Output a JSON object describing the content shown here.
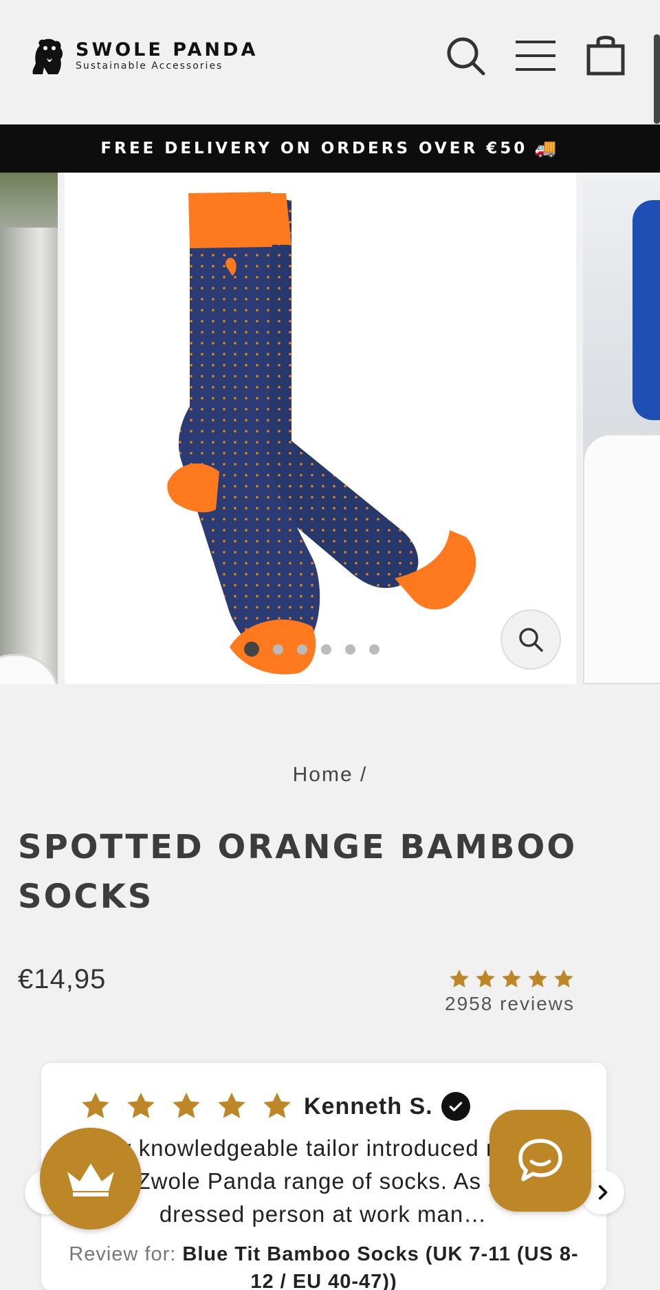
{
  "header": {
    "brand_name": "SWOLE PANDA",
    "brand_tagline": "Sustainable Accessories"
  },
  "banner": {
    "text": "FREE DELIVERY ON ORDERS OVER €50",
    "emoji": "🚚"
  },
  "gallery": {
    "slide_count": 6,
    "active_slide": 1
  },
  "breadcrumb": {
    "home": "Home",
    "separator": "/"
  },
  "product": {
    "title": "SPOTTED ORANGE BAMBOO SOCKS",
    "price": "€14,95",
    "rating_stars": 5,
    "reviews_label": "2958 reviews"
  },
  "review": {
    "stars": 5,
    "author": "Kenneth S.",
    "body": "My knowledgeable tailor introduced me to the Zwole Panda range of socks. As a well dressed person at work man…",
    "for_label": "Review for:",
    "for_product": "Blue Tit Bamboo Socks (UK 7-11 (US 8-12 / EU 40-47))"
  },
  "colors": {
    "accent_gold": "#bd8626",
    "banner_bg": "#0d0d0d",
    "page_bg": "#f1f1f1",
    "sock_navy": "#27386b",
    "sock_orange": "#ff7a1f"
  },
  "icons": {
    "search": "search-icon",
    "menu": "hamburger-menu-icon",
    "cart": "shopping-bag-icon",
    "zoom": "magnifier-icon",
    "chat": "chat-bubble-icon",
    "loyalty": "crown-icon"
  }
}
